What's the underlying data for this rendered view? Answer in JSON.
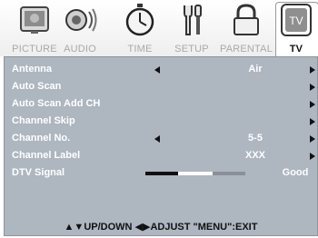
{
  "tabs": [
    {
      "label": "PICTURE",
      "icon": "tv-picture-icon",
      "active": false
    },
    {
      "label": "AUDIO",
      "icon": "speaker-icon",
      "active": false
    },
    {
      "label": "TIME",
      "icon": "stopwatch-icon",
      "active": false
    },
    {
      "label": "SETUP",
      "icon": "tools-icon",
      "active": false
    },
    {
      "label": "PARENTAL",
      "icon": "lock-icon",
      "active": false
    },
    {
      "label": "TV",
      "icon": "tv-icon",
      "active": true
    }
  ],
  "tv_icon_text": "TV",
  "menu": {
    "items": [
      {
        "label": "Antenna",
        "value": "Air"
      },
      {
        "label": "Auto Scan"
      },
      {
        "label": "Auto Scan Add CH"
      },
      {
        "label": "Channel Skip"
      },
      {
        "label": "Channel No.",
        "value": "5-5"
      },
      {
        "label": "Channel Label",
        "value": "XXX"
      },
      {
        "label": "DTV Signal",
        "value": "Good",
        "signal_level": 0.67
      }
    ]
  },
  "footer": "▲▼UP/DOWN  ◀▶ADJUST  \"MENU\":EXIT",
  "colors": {
    "panel": "#aeb6c0",
    "text": "#ffffff",
    "inactive_tab": "#a9a9a9"
  }
}
